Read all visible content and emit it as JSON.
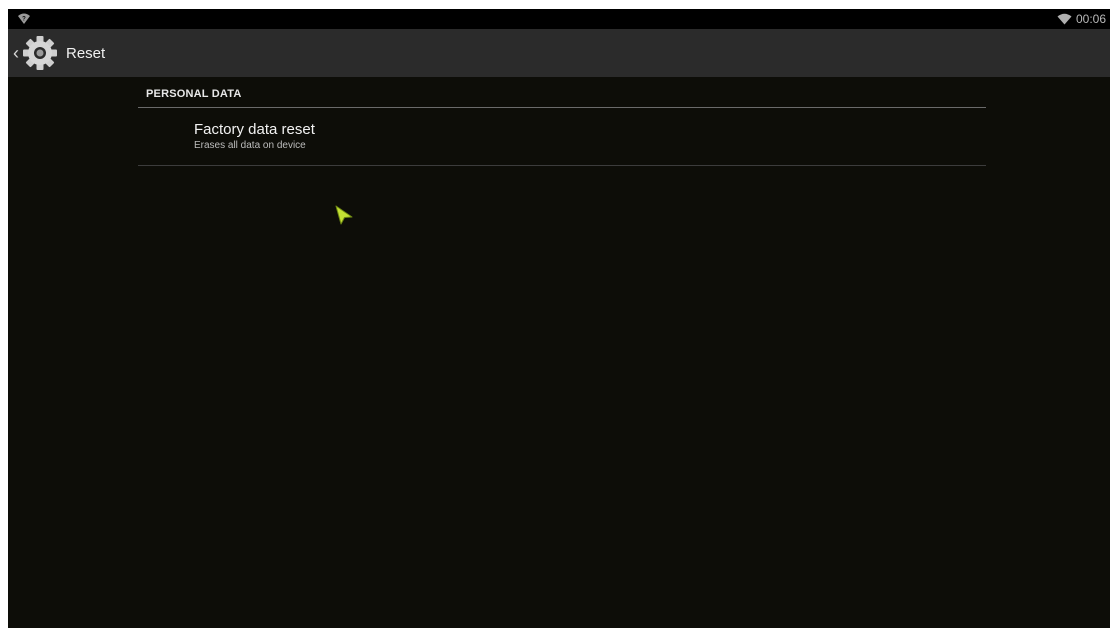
{
  "status_bar": {
    "left_icon": "wifi-question-icon",
    "wifi_icon": "wifi-signal-icon",
    "time": "00:06"
  },
  "action_bar": {
    "up_icon": "chevron-left-icon",
    "app_icon": "settings-gear-icon",
    "title": "Reset"
  },
  "section": {
    "header": "PERSONAL DATA",
    "items": [
      {
        "title": "Factory data reset",
        "summary": "Erases all data on device"
      }
    ]
  },
  "colors": {
    "background": "#0d0d08",
    "action_bar": "#2b2b2b",
    "cursor": "#c4e034"
  }
}
